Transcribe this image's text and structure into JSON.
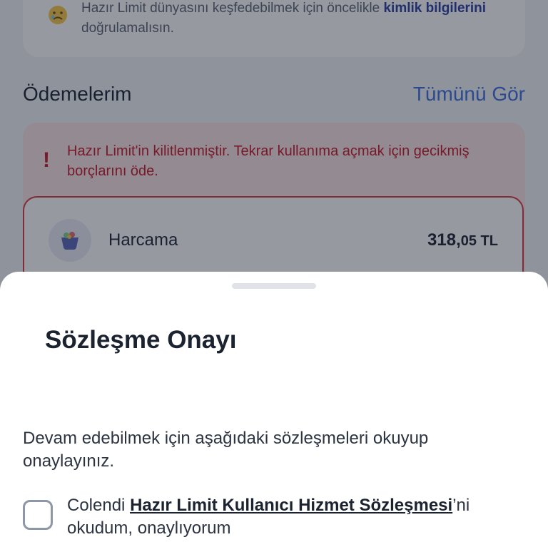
{
  "background": {
    "info_card": {
      "text_before": "Hazır Limit dünyasını keşfedebilmek için öncelikle ",
      "text_bold": "kimlik bilgilerini",
      "text_after": " doğrulamalısın."
    },
    "payments": {
      "title": "Ödemelerim",
      "see_all": "Tümünü Gör",
      "alert_mark": "!",
      "alert_text": "Hazır Limit'in kilitlenmiştir. Tekrar kullanıma açmak için gecikmiş borçlarını öde.",
      "item": {
        "label": "Harcama",
        "amount_main": "318,",
        "amount_cents": "05 TL"
      }
    }
  },
  "sheet": {
    "title": "Sözleşme Onayı",
    "description": "Devam edebilmek için aşağıdaki sözleşmeleri okuyup onaylayınız.",
    "consent": {
      "prefix": "Colendi ",
      "link": "Hazır Limit Kullanıcı Hizmet Sözleşmesi",
      "suffix": "’ni okudum, onaylıyorum",
      "checked": false
    }
  },
  "colors": {
    "accent": "#3f6fe0",
    "alert": "#c7192b",
    "overlay": "rgba(22,28,45,0.45)"
  }
}
